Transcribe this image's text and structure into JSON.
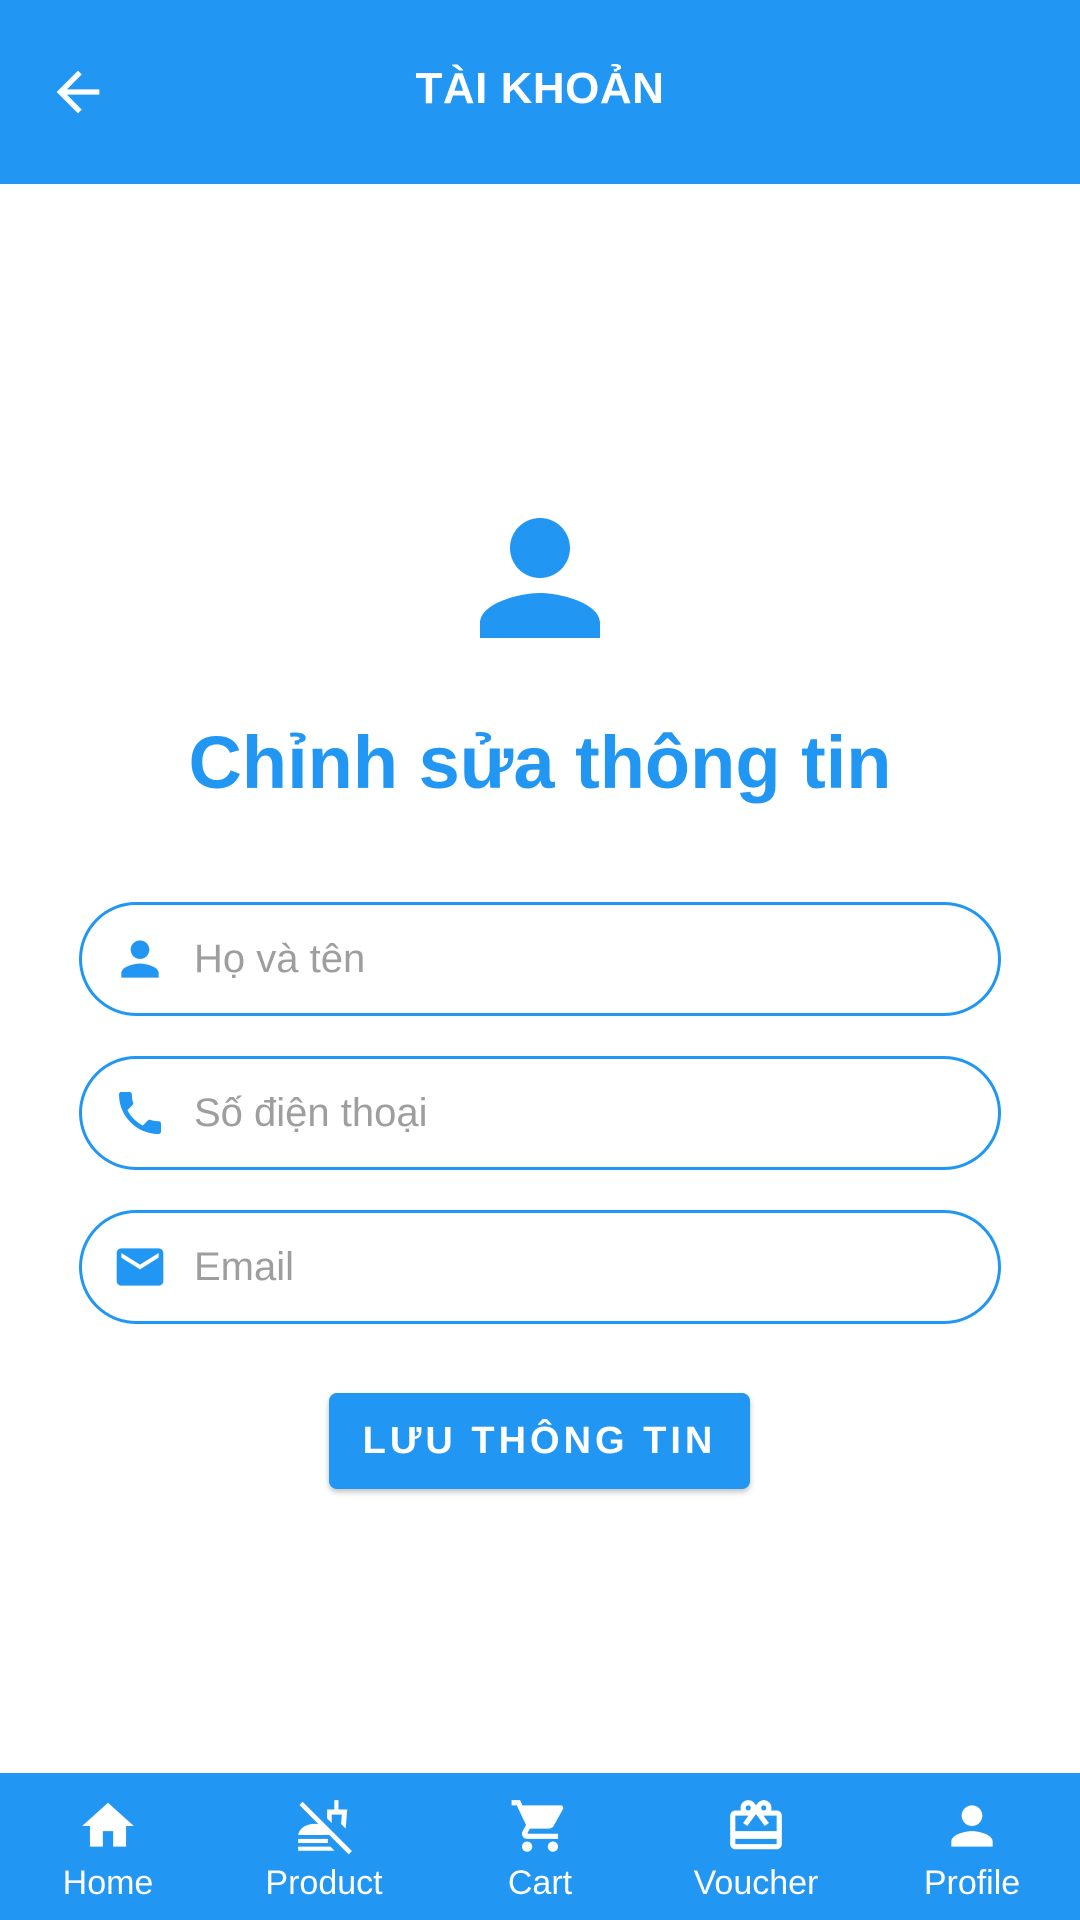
{
  "colors": {
    "primary": "#2196F3",
    "on_primary": "#FFFFFF",
    "placeholder": "#9E9E9E",
    "background": "#FFFFFF"
  },
  "app_bar": {
    "title": "TÀI KHOẢN",
    "back_icon": "arrow-back-icon"
  },
  "profile": {
    "avatar_icon": "person-icon",
    "heading": "Chỉnh sửa thông tin"
  },
  "form": {
    "name": {
      "icon": "person-icon",
      "placeholder": "Họ và tên",
      "value": ""
    },
    "phone": {
      "icon": "phone-icon",
      "placeholder": "Số điện thoại",
      "value": ""
    },
    "email": {
      "icon": "mail-icon",
      "placeholder": "Email",
      "value": ""
    },
    "save_label": "LƯU THÔNG TIN"
  },
  "bottom_nav": {
    "items": [
      {
        "label": "Home",
        "icon": "home-icon"
      },
      {
        "label": "Product",
        "icon": "no-food-icon"
      },
      {
        "label": "Cart",
        "icon": "cart-icon"
      },
      {
        "label": "Voucher",
        "icon": "gift-card-icon"
      },
      {
        "label": "Profile",
        "icon": "person-icon"
      }
    ]
  }
}
